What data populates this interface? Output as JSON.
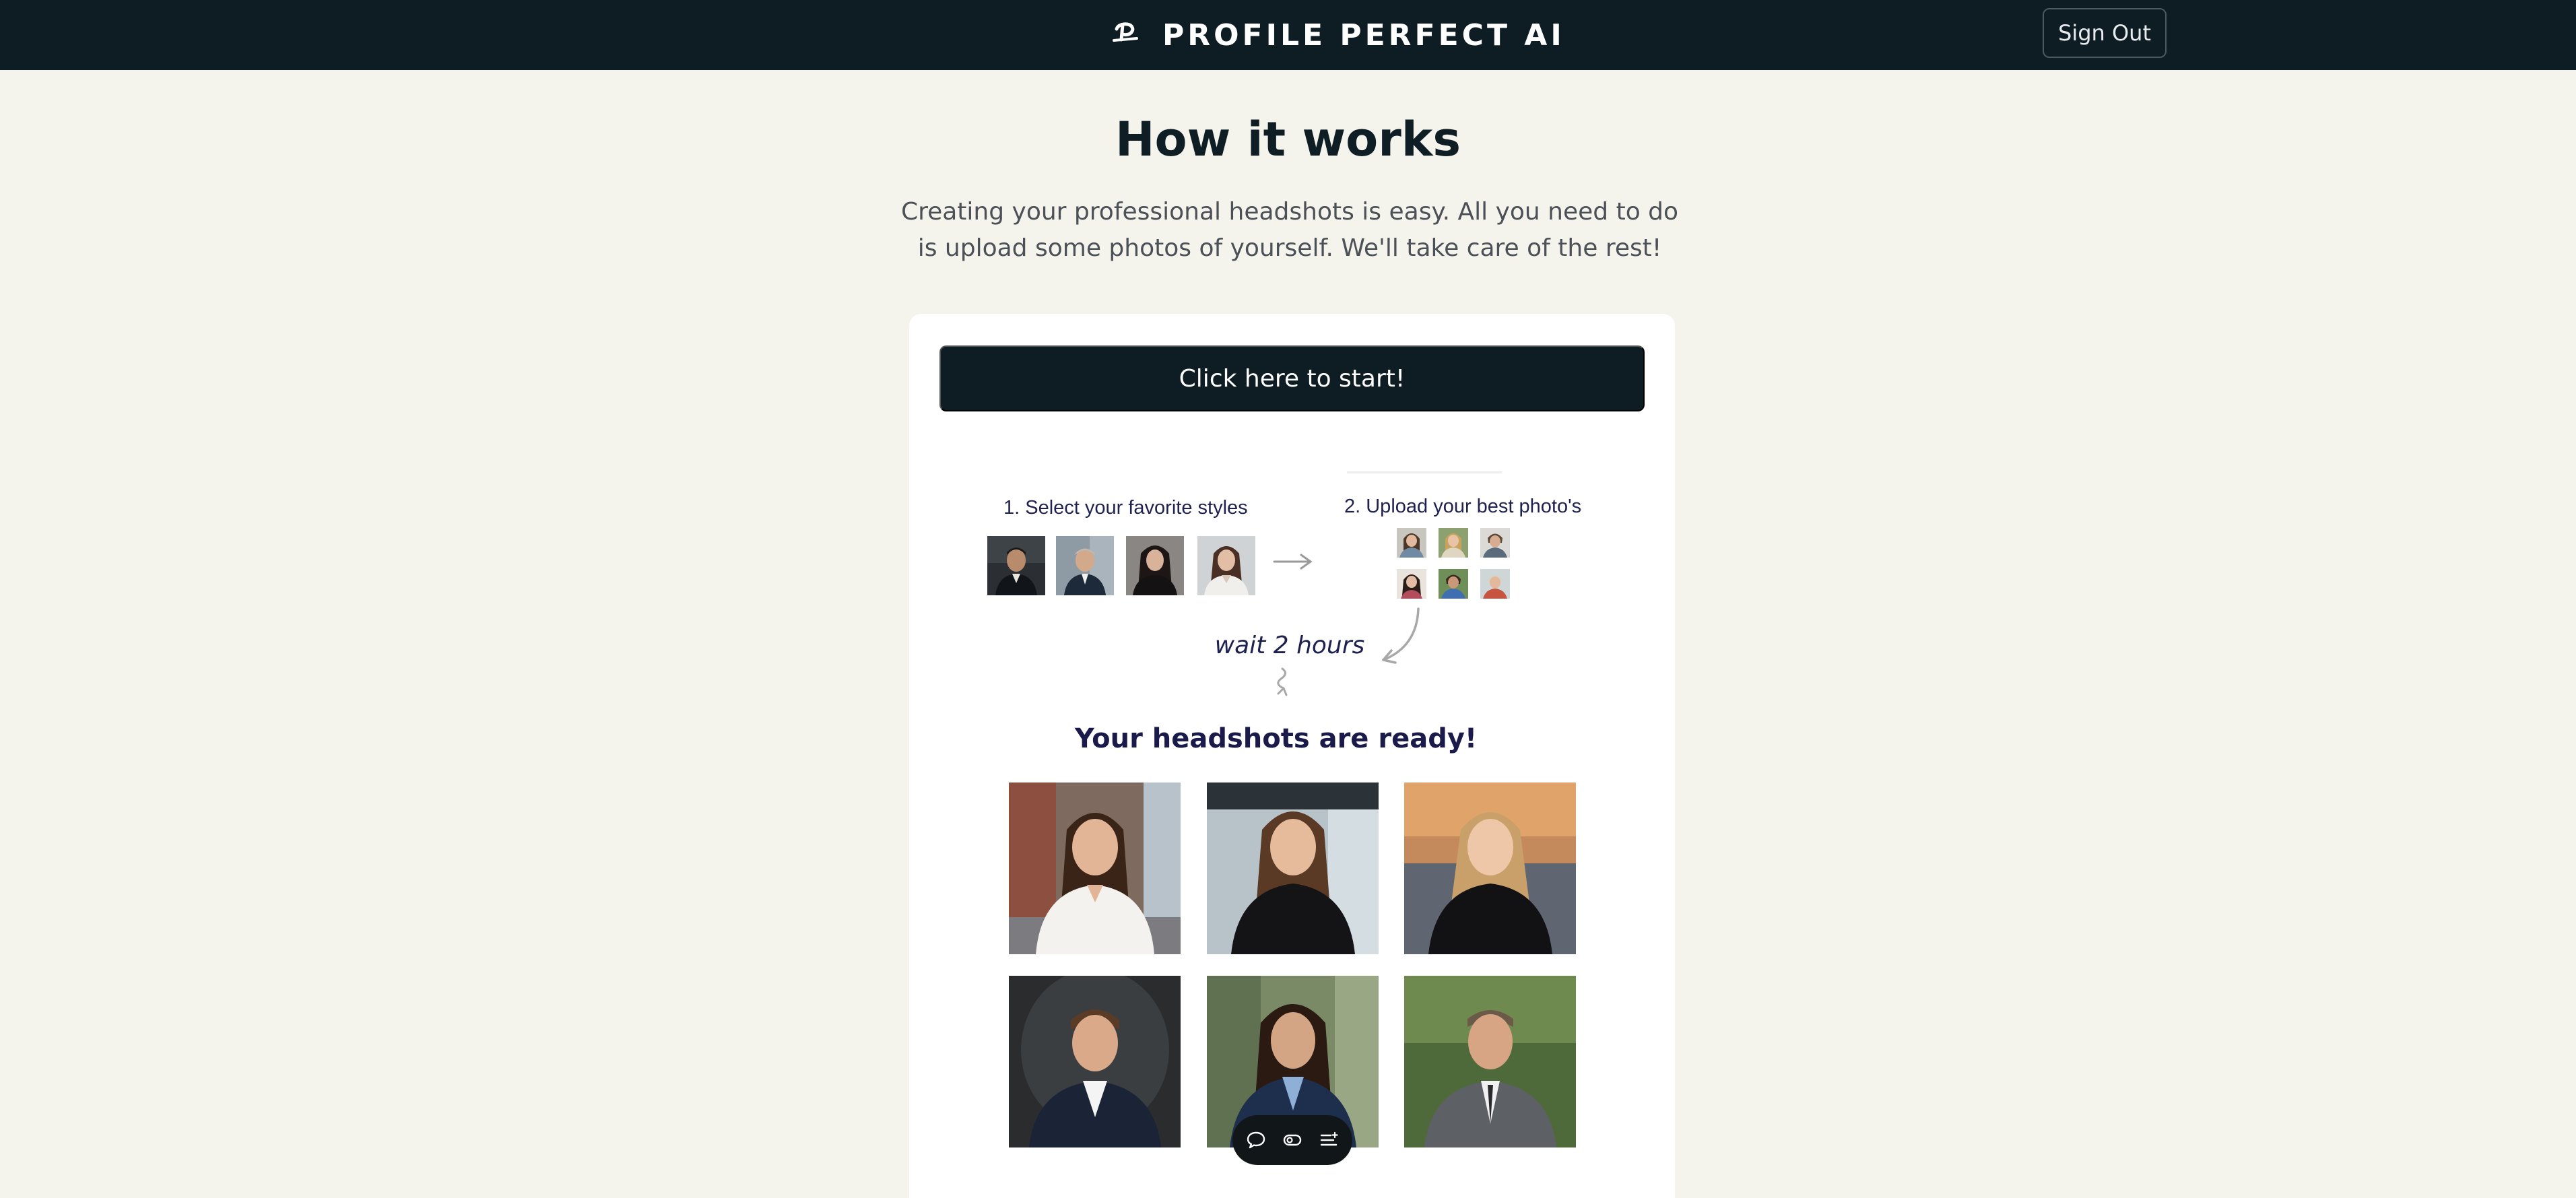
{
  "header": {
    "brand_name": "PROFILE PERFECT AI",
    "logo_icon": "pp-logo-icon",
    "sign_out_label": "Sign Out"
  },
  "main": {
    "title": "How it works",
    "subtitle": "Creating your professional headshots is easy. All you need to do is upload some photos of yourself. We'll take care of the rest!",
    "start_button_label": "Click here to start!"
  },
  "steps": {
    "step1_label": "1.  Select your favorite styles",
    "step2_label": "2. Upload your best photo's",
    "wait_label": "wait 2 hours",
    "ready_label": "Your headshots are ready!"
  },
  "toolbar": {
    "icons": [
      "chat-icon",
      "toggle-icon",
      "list-icon"
    ]
  },
  "colors": {
    "header_bg": "#0e1c23",
    "page_bg": "#f4f3ec",
    "accent_dark": "#0e1c23",
    "text_navy": "#1f2250"
  }
}
